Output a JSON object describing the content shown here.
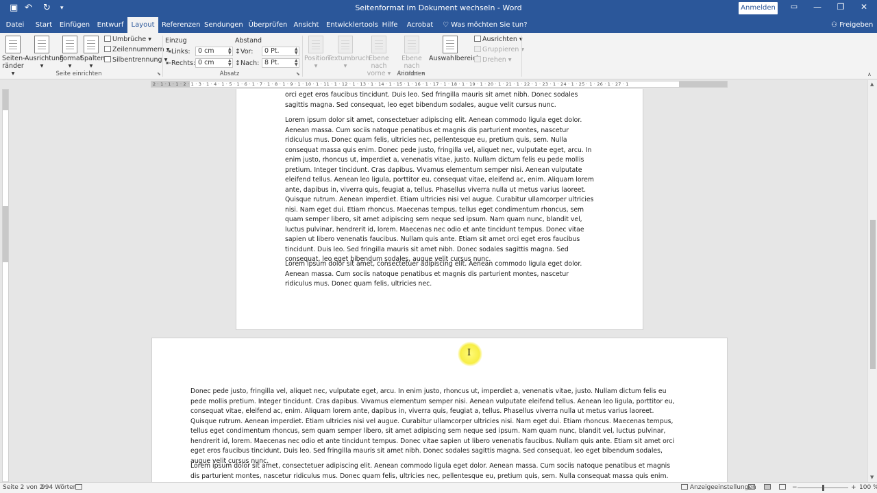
{
  "titlebar": {
    "title": "Seitenformat im Dokument wechseln  -  Word",
    "signin_label": "Anmelden",
    "quick_access": {
      "save_icon": "save-icon",
      "undo_icon": "undo-icon",
      "redo_icon": "redo-icon",
      "customize_icon": "customize-icon"
    },
    "window": {
      "ribbon_display_icon": "ribbon-display-icon",
      "minimize": "—",
      "restore": "❐",
      "close": "✕"
    }
  },
  "tabs": [
    {
      "label": "Datei"
    },
    {
      "label": "Start"
    },
    {
      "label": "Einfügen"
    },
    {
      "label": "Entwurf"
    },
    {
      "label": "Layout"
    },
    {
      "label": "Referenzen"
    },
    {
      "label": "Sendungen"
    },
    {
      "label": "Überprüfen"
    },
    {
      "label": "Ansicht"
    },
    {
      "label": "Entwicklertools"
    },
    {
      "label": "Hilfe"
    },
    {
      "label": "Acrobat"
    }
  ],
  "active_tab": "Layout",
  "tell_me": "Was möchten Sie tun?",
  "share": "Freigeben",
  "ribbon": {
    "page_setup": {
      "group_label": "Seite einrichten",
      "margins": "Seiten-\nränder",
      "margins_1": "Seiten-",
      "margins_2": "ränder ▾",
      "orientation": "Ausrichtung",
      "size": "Format",
      "columns": "Spalten",
      "breaks": "Umbrüche ▾",
      "line_numbers": "Zeilennummern ▾",
      "hyphenation": "Silbentrennung ▾"
    },
    "paragraph": {
      "group_label": "Absatz",
      "indent_head": "Einzug",
      "spacing_head": "Abstand",
      "left_label": "Links:",
      "left_value": "0 cm",
      "right_label": "Rechts:",
      "right_value": "0 cm",
      "before_label": "Vor:",
      "before_value": "0 Pt.",
      "after_label": "Nach:",
      "after_value": "8 Pt."
    },
    "arrange": {
      "group_label": "Anordnen",
      "position": "Position",
      "wrap_1": "Textumbruch",
      "forward_1": "Ebene nach",
      "forward_2": "vorne ▾",
      "backward_1": "Ebene nach",
      "backward_2": "hinten ▾",
      "selection_pane": "Auswahlbereich",
      "align": "Ausrichten ▾",
      "group": "Gruppieren ▾",
      "rotate": "Drehen ▾"
    }
  },
  "ruler": {
    "ticks": "2 · 1 · 1 · 1 · 2 · 1 · 3 · 1 · 4 · 1 · 5 · 1 · 6 · 1 · 7 · 1 · 8 · 1 · 9 · 1 · 10 · 1 · 11 · 1 · 12 · 1 · 13 · 1 · 14 · 1 · 15 · 1 · 16 · 1 · 17 · 1 · 18 · 1 · 19 · 1 · 20 · 1 · 21 · 1 · 22 · 1 · 23 · 1 · 24 · 1 · 25 · 1 · 26 · 1 · 27 · 1"
  },
  "document": {
    "page1": {
      "p0": "orci eget eros faucibus tincidunt. Duis leo. Sed fringilla mauris sit amet nibh. Donec sodales sagittis magna. Sed consequat, leo eget bibendum sodales, augue velit cursus nunc.",
      "p1": "Lorem ipsum dolor sit amet, consectetuer adipiscing elit. Aenean commodo ligula eget dolor. Aenean massa. Cum sociis natoque penatibus et magnis dis parturient montes, nascetur ridiculus mus. Donec quam felis, ultricies nec, pellentesque eu, pretium quis, sem. Nulla consequat massa quis enim. Donec pede justo, fringilla vel, aliquet nec, vulputate eget, arcu. In enim justo, rhoncus ut, imperdiet a, venenatis vitae, justo. Nullam dictum felis eu pede mollis pretium. Integer tincidunt. Cras dapibus. Vivamus elementum semper nisi. Aenean vulputate eleifend tellus. Aenean leo ligula, porttitor eu, consequat vitae, eleifend ac, enim. Aliquam lorem ante, dapibus in, viverra quis, feugiat a, tellus. Phasellus viverra nulla ut metus varius laoreet. Quisque rutrum. Aenean imperdiet. Etiam ultricies nisi vel augue. Curabitur ullamcorper ultricies nisi. Nam eget dui. Etiam rhoncus. Maecenas tempus, tellus eget condimentum rhoncus, sem quam semper libero, sit amet adipiscing sem neque sed ipsum. Nam quam nunc, blandit vel, luctus pulvinar, hendrerit id, lorem. Maecenas nec odio et ante tincidunt tempus. Donec vitae sapien ut libero venenatis faucibus. Nullam quis ante. Etiam sit amet orci eget eros faucibus tincidunt. Duis leo. Sed fringilla mauris sit amet nibh. Donec sodales sagittis magna. Sed consequat, leo eget bibendum sodales, augue velit cursus nunc.",
      "p2": "Lorem ipsum dolor sit amet, consectetuer adipiscing elit. Aenean commodo ligula eget dolor. Aenean massa. Cum sociis natoque penatibus et magnis dis parturient montes, nascetur ridiculus mus. Donec quam felis, ultricies nec."
    },
    "page2": {
      "p0": "Donec pede justo, fringilla vel, aliquet nec, vulputate eget, arcu. In enim justo, rhoncus ut, imperdiet a, venenatis vitae, justo. Nullam dictum felis eu pede mollis pretium. Integer tincidunt. Cras dapibus. Vivamus elementum semper nisi. Aenean vulputate eleifend tellus. Aenean leo ligula, porttitor eu, consequat vitae, eleifend ac, enim. Aliquam lorem ante, dapibus in, viverra quis, feugiat a, tellus. Phasellus viverra nulla ut metus varius laoreet. Quisque rutrum. Aenean imperdiet. Etiam ultricies nisi vel augue. Curabitur ullamcorper ultricies nisi. Nam eget dui. Etiam rhoncus. Maecenas tempus, tellus eget condimentum rhoncus, sem quam semper libero, sit amet adipiscing sem neque sed ipsum. Nam quam nunc, blandit vel, luctus pulvinar, hendrerit id, lorem. Maecenas nec odio et ante tincidunt tempus. Donec vitae sapien ut libero venenatis faucibus. Nullam quis ante. Etiam sit amet orci eget eros faucibus tincidunt. Duis leo. Sed fringilla mauris sit amet nibh. Donec sodales sagittis magna. Sed consequat, leo eget bibendum sodales, augue velit cursus nunc.",
      "p1": "Lorem ipsum dolor sit amet, consectetuer adipiscing elit. Aenean commodo ligula eget dolor. Aenean massa. Cum sociis natoque penatibus et magnis dis parturient montes, nascetur ridiculus mus. Donec quam felis, ultricies nec, pellentesque eu, pretium quis, sem. Nulla consequat massa quis enim. Donec pede"
    }
  },
  "cursor": "I",
  "status": {
    "page": "Seite 2 von 2",
    "words": "994 Wörter",
    "display_settings": "Anzeigeeinstellungen",
    "zoom": "100 %",
    "zoom_out": "−",
    "zoom_in": "+"
  },
  "colors": {
    "accent": "#2b579a",
    "ribbon_bg": "#f3f3f3",
    "canvas_bg": "#e6e6e6",
    "highlight": "#f7ee45"
  }
}
